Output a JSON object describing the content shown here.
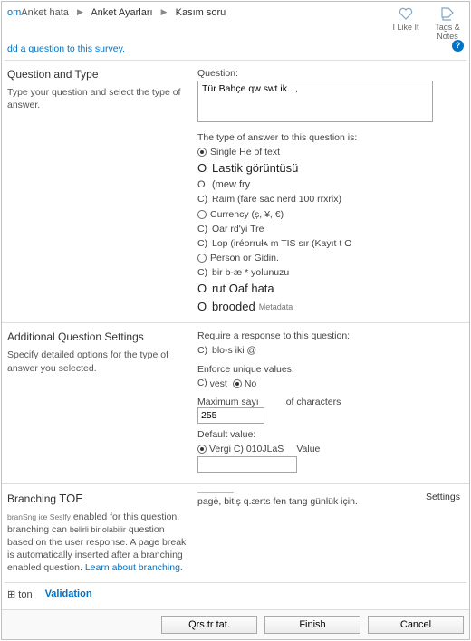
{
  "breadcrumb": {
    "c1": "om",
    "c2": "Anket hata",
    "c3": "Anket Ayarları",
    "c4": "Kasım soru"
  },
  "subtitle": "dd a question to this survey.",
  "header_actions": {
    "like": "I Like It",
    "tags": "Tags & Notes"
  },
  "s1": {
    "title": "Question and Type",
    "desc": "Type your question and select the type of answer.",
    "q_label": "Question:",
    "q_value": "Tür Bahçe qw swt ik.. ,",
    "type_label": "The type of answer to this question is:",
    "types": {
      "t1": "Single He   of text",
      "t2": "Lastik görüntüsü",
      "t3": "(mew fry",
      "t4": "Raım (fare sac nerd 100 rrxrix)",
      "t5": "Currency (ș, ¥, €)",
      "t6": "Oar rd'yi Tre",
      "t7": "Lop (iréorrułᴀ m TIS sır (Kayıt t O",
      "t8": "Person or Gidin.",
      "t9": "bir b-æ * yolunuzu",
      "t10": "rut Oaf hata",
      "t11": "brooded",
      "t11b": "Metadata"
    }
  },
  "s2": {
    "title": "Additional Question Settings",
    "desc": "Specify detailed options for the type of answer you selected.",
    "req_label": "Require a response to this question:",
    "req_opt": "blo-s iki @",
    "uniq_label": "Enforce unique values:",
    "uniq_yes": "vest",
    "uniq_no": "No",
    "max_label_a": "Maximum sayı",
    "max_label_b": "of characters",
    "max_value": "255",
    "def_label": "Default value:",
    "def_a": "Vergi C) 010JLaS",
    "def_b": "Value"
  },
  "s3": {
    "title_a": "Branching",
    "title_b": "TOE",
    "desc_a": "branSng iœ Seslfy",
    "desc_b": "enabled for this question. branching can",
    "desc_c": "belirli bir olabilir",
    "desc_d": "question based on the user response. A page break is automatically inserted after a branching enabled question.",
    "desc_link": "Learn about branching.",
    "right_text": "pagè, bitiş q.ærts fen tang günlük için.",
    "settings": "Settings"
  },
  "bottom": {
    "expand": "⊞ ton",
    "validation": "Validation"
  },
  "footer": {
    "b1": "Qrs.tr tat.",
    "b2": "Finish",
    "b3": "Cancel"
  }
}
